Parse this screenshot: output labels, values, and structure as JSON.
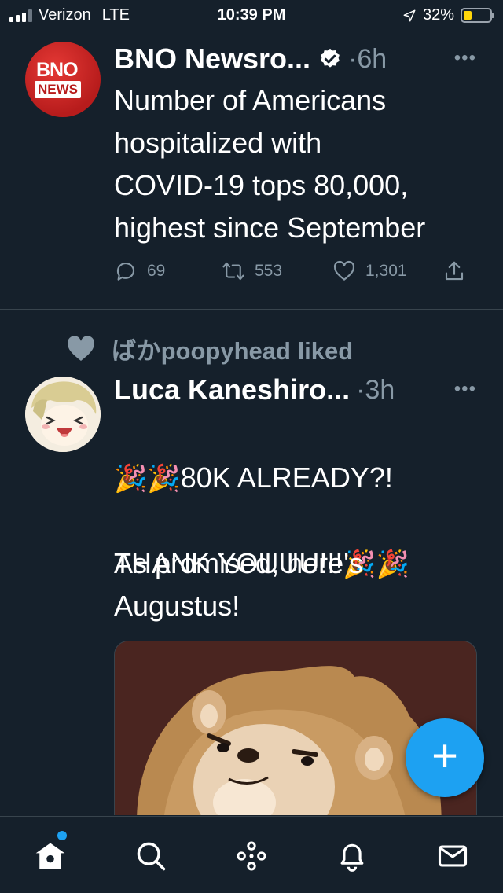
{
  "status_bar": {
    "carrier": "Verizon",
    "network": "LTE",
    "time": "10:39 PM",
    "battery": "32%",
    "battery_level": 0.32,
    "icons": [
      "signal-icon",
      "location-arrow-icon",
      "battery-icon"
    ]
  },
  "tweets": [
    {
      "author": "BNO Newsro...",
      "verified": true,
      "time": "6h",
      "avatar_top_text": "BNO",
      "avatar_bottom_text": "NEWS",
      "text": "Number of Americans\nhospitalized with\nCOVID-19 tops 80,000,\nhighest since September",
      "replies": "69",
      "retweets": "553",
      "likes": "1,301"
    },
    {
      "social_context": "ばかpoopyhead liked",
      "author": "Luca Kaneshiro...",
      "time": "3h",
      "text_line1": "80K ALREADY?!",
      "text_line2": "THANK YOUUU!!!",
      "text_para2": "As promised, here's\nAugustus!"
    }
  ],
  "tab_bar": {
    "tabs": [
      "home",
      "search",
      "spaces",
      "notifications",
      "messages"
    ]
  },
  "colors": {
    "background": "#15202b",
    "accent": "#1da1f2",
    "secondary_text": "#8899a6",
    "divider": "#38444d"
  }
}
